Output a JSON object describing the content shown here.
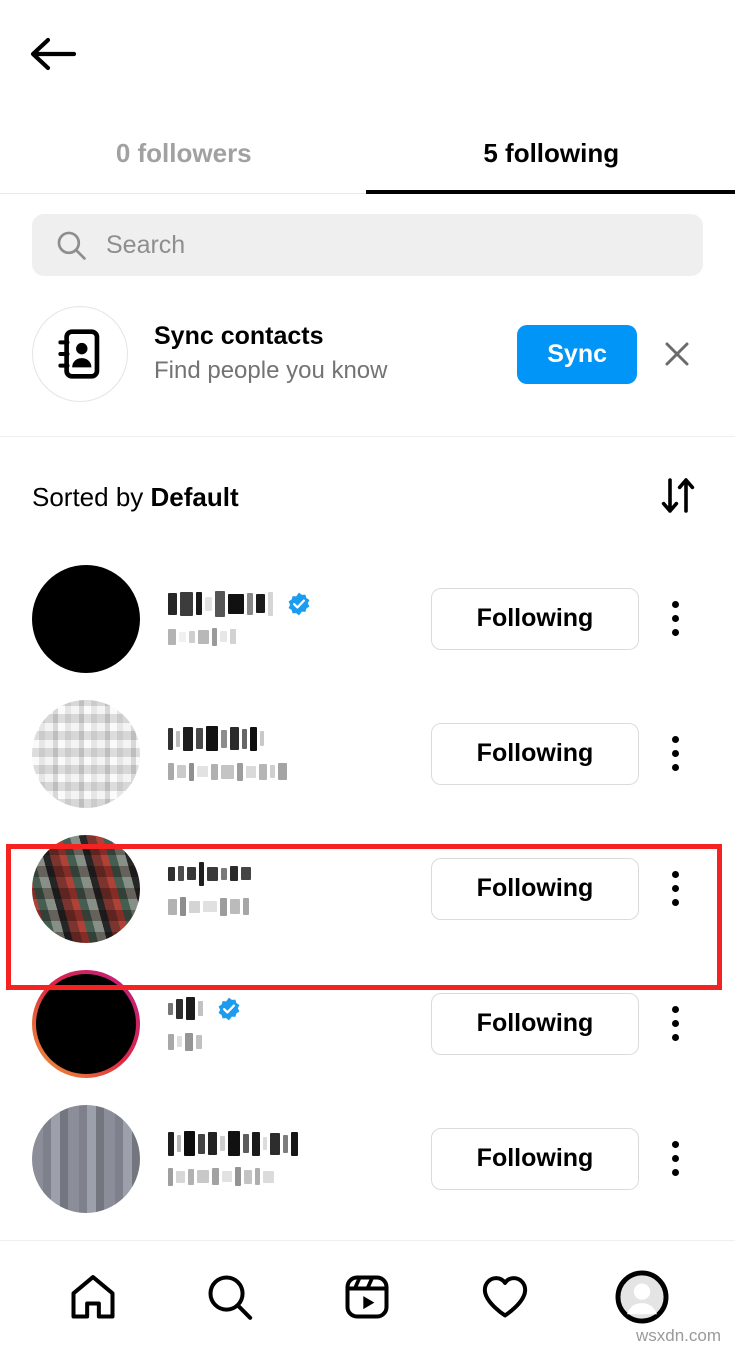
{
  "header": {
    "back_icon": "arrow-left-icon"
  },
  "tabs": [
    {
      "label": "0 followers",
      "active": false
    },
    {
      "label": "5 following",
      "active": true
    }
  ],
  "search": {
    "placeholder": "Search",
    "value": "",
    "icon": "search-icon"
  },
  "sync": {
    "icon": "contact-book-icon",
    "title": "Sync contacts",
    "subtitle": "Find people you know",
    "button_label": "Sync",
    "button_color": "#0095f6",
    "close_icon": "close-icon"
  },
  "sort": {
    "prefix": "Sorted by ",
    "value": "Default",
    "icon": "sort-arrows-icon"
  },
  "list": {
    "follow_button_label": "Following",
    "more_icon": "more-vertical-icon",
    "rows": [
      {
        "username_censored": true,
        "verified": true,
        "avatar_style": "black",
        "has_subtitle": true,
        "highlighted": false
      },
      {
        "username_censored": true,
        "verified": false,
        "avatar_style": "white-noise",
        "has_subtitle": true,
        "highlighted": false
      },
      {
        "username_censored": true,
        "verified": false,
        "avatar_style": "color-photo",
        "has_subtitle": true,
        "highlighted": true
      },
      {
        "username_censored": true,
        "verified": true,
        "avatar_style": "black-ring",
        "has_subtitle": true,
        "highlighted": false
      },
      {
        "username_censored": true,
        "verified": false,
        "avatar_style": "gray",
        "has_subtitle": true,
        "highlighted": false
      }
    ]
  },
  "bottom_nav": [
    {
      "icon": "home-icon",
      "active": false
    },
    {
      "icon": "search-icon",
      "active": false
    },
    {
      "icon": "reels-icon",
      "active": false
    },
    {
      "icon": "heart-icon",
      "active": false
    },
    {
      "icon": "profile-avatar-icon",
      "active": true
    }
  ],
  "watermark": "wsxdn.com",
  "colors": {
    "accent_blue": "#0095f6",
    "verified_blue": "#1d9bf0",
    "highlight_red": "#f52222",
    "inactive_tab": "#a1a1a1",
    "search_bg": "#efefef",
    "border": "#dbdbdb"
  }
}
